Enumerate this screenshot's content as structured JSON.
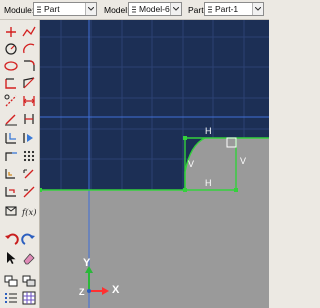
{
  "context_bar": {
    "module_label": "Module:",
    "module_value": "Part",
    "model_label": "Model:",
    "model_value": "Model-6",
    "part_label": "Part:",
    "part_value": "Part-1"
  },
  "constraints": {
    "top_h": "H",
    "bottom_h": "H",
    "left_v": "V",
    "right_v": "V"
  },
  "triad": {
    "y": "Y",
    "x": "X",
    "z": "Z"
  },
  "colors": {
    "viewport_background": "#1c2f55",
    "part_fill": "#9a9a9a",
    "sketch_geometry": "#34d13c",
    "construction_line": "#3f6fd8",
    "grid": "#2c4272"
  },
  "toolbox_tools": [
    "point-icon",
    "spline-icon",
    "circle-icon",
    "arc-icon",
    "ellipse-icon",
    "fillet-icon",
    "rectangle-icon",
    "polygon-icon",
    "construction-icon",
    "dimension-icon",
    "edit-dimension-icon",
    "constraint-icon",
    "offset-icon",
    "pattern-icon",
    "extend-icon",
    "trim-icon",
    "split-icon",
    "translate-icon",
    "rotate-icon",
    "parameter-icon",
    "undo-icon",
    "redo-icon",
    "select-icon",
    "delete-icon",
    "copy-icon",
    "mirror-icon",
    "layers-icon",
    "grid-icon"
  ]
}
